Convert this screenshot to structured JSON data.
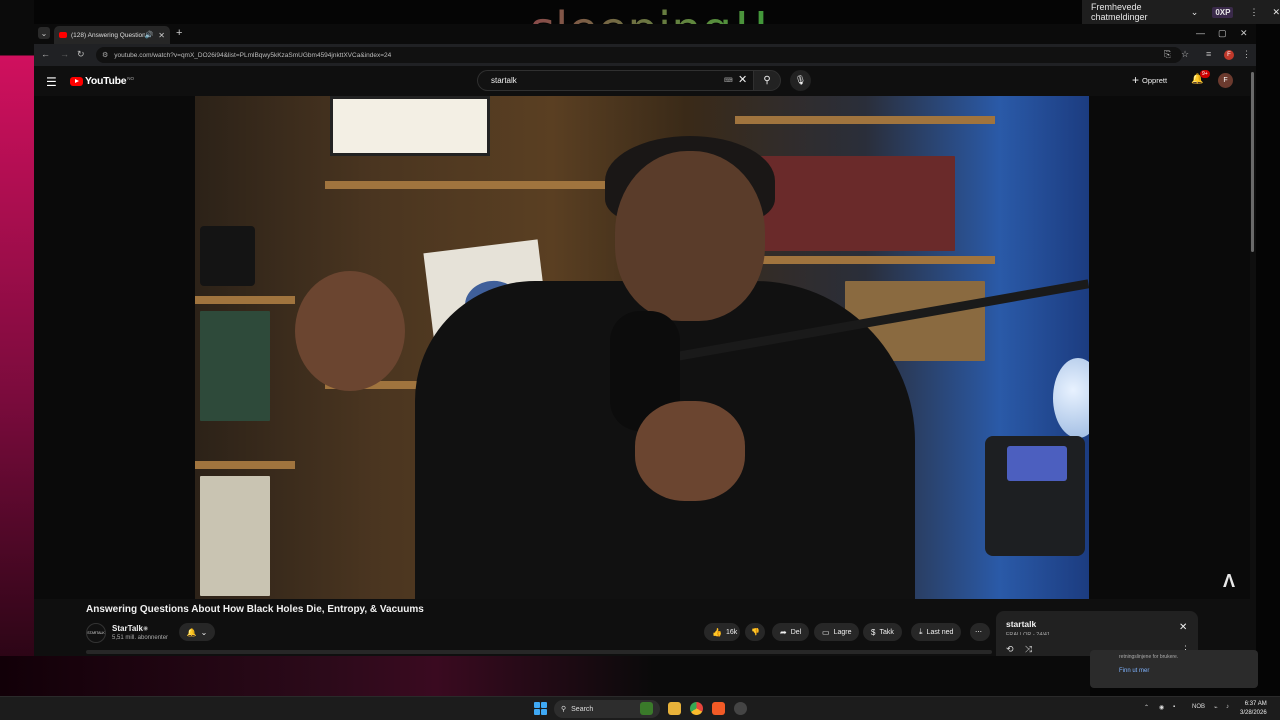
{
  "overlay": {
    "caption": "sleeping!!"
  },
  "top_right_overlay": {
    "label": "Fremhevede chatmeldinger",
    "badge": "0XP"
  },
  "browser": {
    "tab_title": "(128) Answering Question...",
    "url": "youtube.com/watch?v=qmX_DO26i94&list=PLmlBqwy5kKzaSmUGbm4594jnkttXVCa&index=24",
    "profile_initial": "F"
  },
  "youtube": {
    "logo_text": "YouTube",
    "logo_country": "NO",
    "search_value": "startalk",
    "create_label": "Opprett",
    "notification_badge": "9+",
    "avatar_initial": "F"
  },
  "video": {
    "title": "Answering Questions About How Black Holes Die, Entropy, & Vacuums",
    "channel_name": "StarTalk",
    "channel_logo_text": "STARTALK",
    "subscribers": "5,51 mill. abonnenter",
    "likes": "16k",
    "share_label": "Del",
    "save_label": "Lagre",
    "thanks_label": "Takk",
    "download_label": "Last ned"
  },
  "playlist": {
    "title": "startalk",
    "subtitle": "FRALLOR - 24/41"
  },
  "notification": {
    "text": "retningslinjene for brukere.",
    "link": "Finn ut mer"
  },
  "taskbar": {
    "search_label": "Search",
    "language": "NOB",
    "time": "6:37 AM",
    "date": "3/28/2026"
  }
}
